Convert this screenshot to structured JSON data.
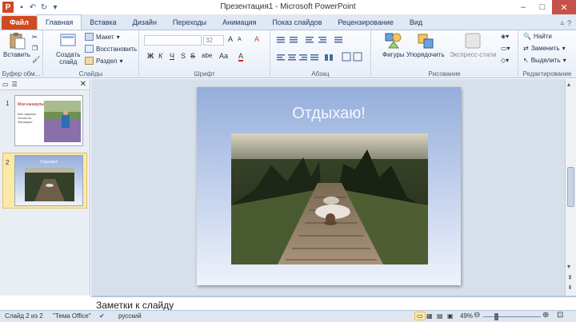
{
  "window": {
    "title": "Презентация1 - Microsoft PowerPoint",
    "app_letter": "P",
    "qat_icons": [
      "save-icon",
      "undo-icon",
      "redo-icon",
      "customize-icon"
    ]
  },
  "tabs": [
    "Файл",
    "Главная",
    "Вставка",
    "Дизайн",
    "Переходы",
    "Анимация",
    "Показ слайдов",
    "Рецензирование",
    "Вид"
  ],
  "ribbon": {
    "clipboard": {
      "paste": "Вставить",
      "label": "Буфер обм..."
    },
    "slides": {
      "new_slide_1": "Создать",
      "new_slide_2": "слайд",
      "layout": "Макет",
      "reset": "Восстановить",
      "section": "Раздел",
      "label": "Слайды"
    },
    "font": {
      "size": "32",
      "label": "Шрифт",
      "bold": "Ж",
      "italic": "К",
      "underline": "Ч",
      "strike": "S",
      "spacing": "abe",
      "case": "Aa",
      "grow": "A",
      "shrink": "A",
      "clear": "A"
    },
    "paragraph": {
      "label": "Абзац"
    },
    "drawing": {
      "shapes": "Фигуры",
      "arrange": "Упорядочить",
      "quick_styles": "Экспресс-стили",
      "label": "Рисование"
    },
    "editing": {
      "find": "Найти",
      "replace": "Заменить",
      "select": "Выделить",
      "label": "Редактирование"
    }
  },
  "slides_pane": {
    "thumb1_num": "1",
    "thumb1_title": "Мои каникулы",
    "thumb1_text": "Как отдыхал летом на Фальмусе",
    "thumb2_num": "2",
    "thumb2_title": "Отдыхаю!"
  },
  "slide": {
    "title": "Отдыхаю!"
  },
  "notes": {
    "placeholder": "Заметки к слайду"
  },
  "status": {
    "slide_info": "Слайд 2 из 2",
    "theme": "\"Тема Office\"",
    "language": "русский",
    "zoom": "49%",
    "zoom_level": 0.49
  },
  "colors": {
    "file_tab": "#d04a1f",
    "accent": "#2b579a",
    "slide_bg_top": "#95aedb"
  }
}
